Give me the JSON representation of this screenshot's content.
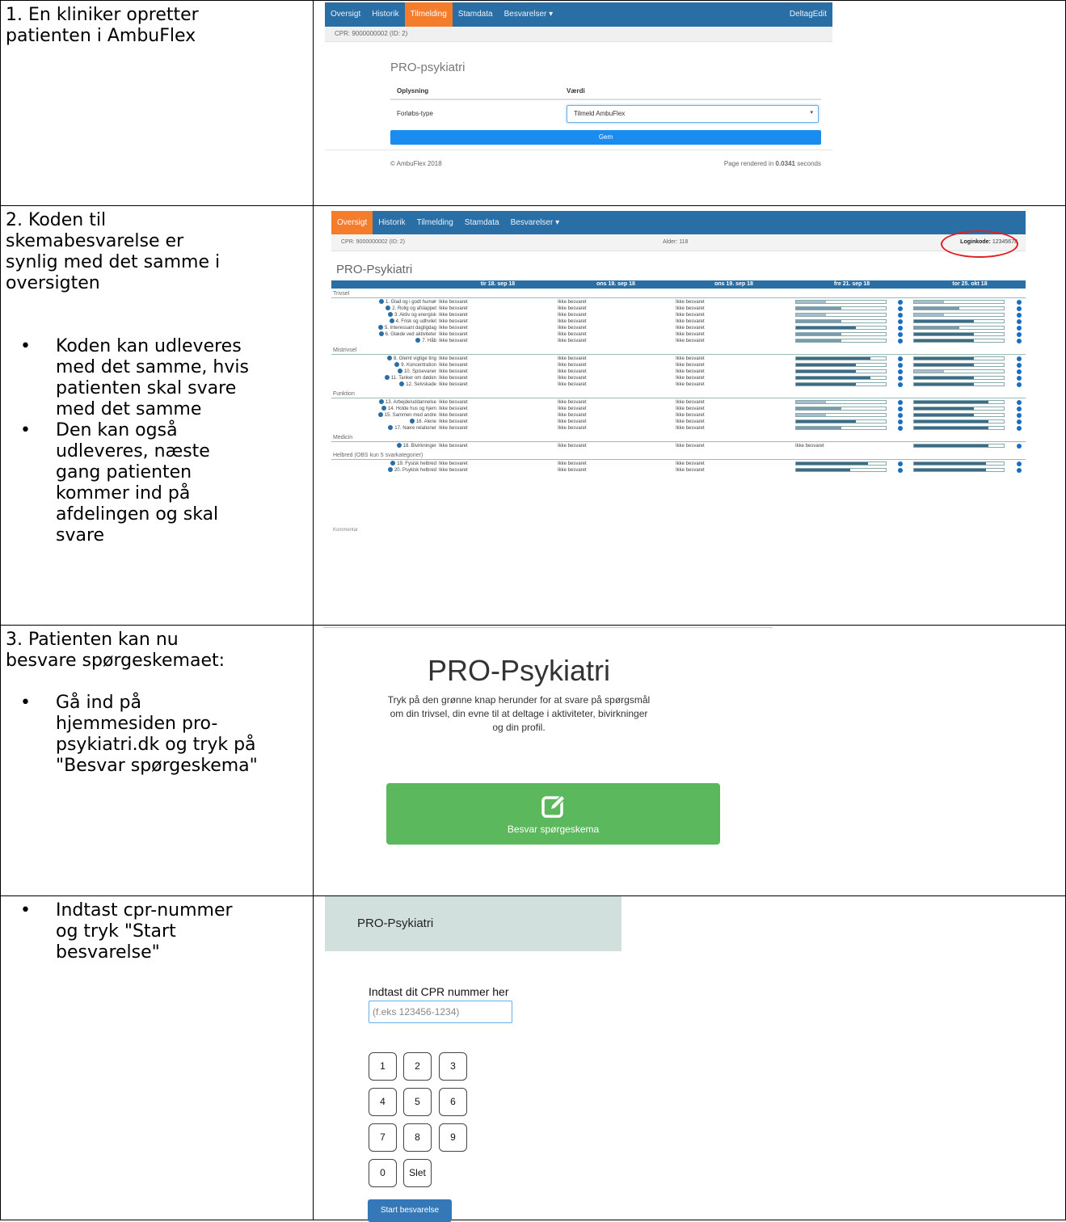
{
  "left_column": {
    "row1": {
      "text": [
        "1. En kliniker opretter",
        "patienten i AmbuFlex"
      ]
    },
    "row2": {
      "text": [
        "2. Koden til",
        "skemabesvarelse er",
        "synlig med det samme i",
        "oversigten"
      ],
      "bullets": [
        [
          "Koden kan udleveres",
          "med det samme, hvis",
          "patienten skal svare",
          "med det samme"
        ],
        [
          "Den kan også",
          "udleveres, næste",
          "gang patienten",
          "kommer ind på",
          "afdelingen og skal",
          "svare"
        ]
      ]
    },
    "row3": {
      "text": [
        "3. Patienten kan nu",
        "besvare spørgeskemaet:"
      ],
      "bullets": [
        [
          "Gå ind på",
          "hjemmesiden pro-",
          "psykiatri.dk og tryk på",
          "\"Besvar spørgeskema\""
        ]
      ]
    },
    "row4": {
      "bullets": [
        [
          "Indtast cpr-nummer",
          "og tryk \"Start",
          "besvarelse\""
        ]
      ]
    }
  },
  "screen1": {
    "nav": [
      "Oversigt",
      "Historik",
      "Tilmelding",
      "Stamdata",
      "Besvarelser ▾"
    ],
    "nav_active": "Tilmelding",
    "nav_right": "DeltagEdit",
    "cpr": "CPR: 9000000002 (ID: 2)",
    "title": "PRO-psykiatri",
    "col_oplysning": "Oplysning",
    "col_vaerdi": "Værdi",
    "field_label": "Forløbs-type",
    "select_value": "Tilmeld AmbuFlex",
    "save_button": "Gem",
    "footer_left": "© AmbuFlex 2018",
    "footer_right_pre": "Page rendered in ",
    "footer_right_bold": "0.0341",
    "footer_right_post": " seconds",
    "colors": {
      "nav": "#2a6ea6",
      "active": "#f47c2b",
      "button": "#1a8cf0"
    }
  },
  "screen2": {
    "nav": [
      "Oversigt",
      "Historik",
      "Tilmelding",
      "Stamdata",
      "Besvarelser ▾"
    ],
    "nav_active": "Oversigt",
    "cpr": "CPR: 9000000002 (ID: 2)",
    "age": "Alder: 118",
    "login_label": "Loginkode:",
    "login_code": "12345678",
    "title": "PRO-Psykiatri",
    "dates": [
      "tir 18. sep 18",
      "ons 19. sep 18",
      "ons 19. sep 18",
      "fre 21. sep 18",
      "tor 25. okt 18"
    ],
    "not_answered": "Ikke besvaret",
    "sections": [
      {
        "name": "Trivsel",
        "items": [
          {
            "label": "1. Glad og i godt humør",
            "d4": 0.33,
            "d5": 0.33
          },
          {
            "label": "2. Rolig og afslappet",
            "d4": 0.5,
            "d5": 0.5
          },
          {
            "label": "3. Aktiv og energisk",
            "d4": 0.33,
            "d5": 0.33
          },
          {
            "label": "4. Frisk og udhvilet",
            "d4": 0.5,
            "d5": 0.67
          },
          {
            "label": "5. Interessant dagligdag",
            "d4": 0.67,
            "d5": 0.5
          },
          {
            "label": "6. Glæde ved aktiviteter",
            "d4": 0.5,
            "d5": 0.67
          },
          {
            "label": "7. Håb",
            "d4": 0.5,
            "d5": 0.67
          }
        ]
      },
      {
        "name": "Mistrivsel",
        "items": [
          {
            "label": "8. Glemt vigtige ting",
            "d4": 0.83,
            "d5": 0.67
          },
          {
            "label": "9. Koncentration",
            "d4": 0.67,
            "d5": 0.67
          },
          {
            "label": "10. Spisevaner",
            "d4": 0.67,
            "d5": 0.33
          },
          {
            "label": "11. Tanker om døden",
            "d4": 0.83,
            "d5": 0.67
          },
          {
            "label": "12. Selvskade",
            "d4": 0.67,
            "d5": 0.67
          }
        ]
      },
      {
        "name": "Funktion",
        "items": [
          {
            "label": "13. Arbejde/uddannelse",
            "d4": 0.33,
            "d5": 0.83
          },
          {
            "label": "14. Holde hus og hjem",
            "d4": 0.5,
            "d5": 0.67
          },
          {
            "label": "15. Sammen med andre",
            "d4": 0.33,
            "d5": 0.67
          },
          {
            "label": "16. Alene",
            "d4": 0.67,
            "d5": 0.83
          },
          {
            "label": "17. Nære relationer",
            "d4": 0.5,
            "d5": 0.83
          }
        ]
      },
      {
        "name": "Medicin",
        "items": [
          {
            "label": "18. Bivirkninger",
            "d4": null,
            "d5": 0.83
          }
        ]
      },
      {
        "name": "Helbred (OBS kun 5 svarkategorier)",
        "items": [
          {
            "label": "19. Fysisk helbred",
            "d4": 0.8,
            "d5": 0.8
          },
          {
            "label": "20. Psykisk helbred",
            "d4": 0.6,
            "d5": 0.8
          }
        ]
      }
    ],
    "next_section": "Kommentar"
  },
  "screen3": {
    "title": "PRO-Psykiatri",
    "text": [
      "Tryk på den grønne knap herunder for at svare på spørgsmål",
      "om din trivsel, din evne til at deltage i aktiviteter, bivirkninger",
      "og din profil."
    ],
    "button_icon": "edit-icon",
    "button_label": "Besvar spørgeskema",
    "button_color": "#5cb85c"
  },
  "screen4": {
    "header": "PRO-Psykiatri",
    "cpr_label": "Indtast dit CPR nummer her",
    "cpr_placeholder": "(f.eks 123456-1234)",
    "keys": [
      "1",
      "2",
      "3",
      "4",
      "5",
      "6",
      "7",
      "8",
      "9",
      "0",
      "Slet"
    ],
    "start_button": "Start besvarelse",
    "header_color": "#d1e0dc",
    "button_color": "#3478b8"
  }
}
